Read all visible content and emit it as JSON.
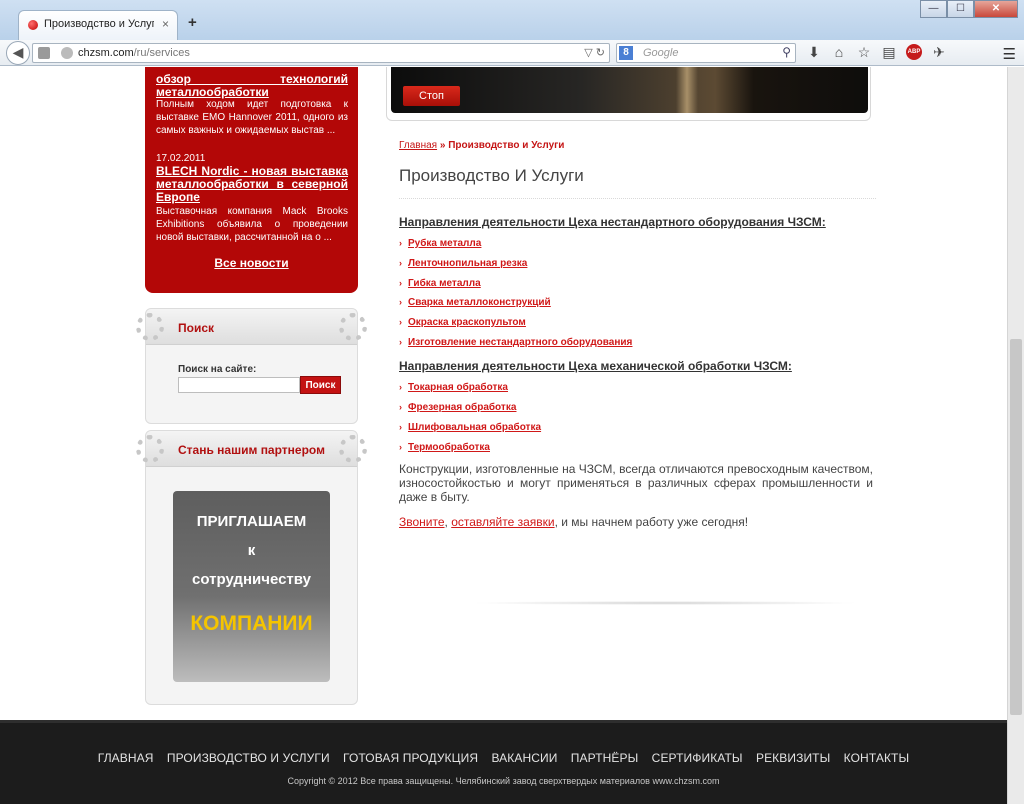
{
  "browser": {
    "tab_title": "Производство и Услуги | ...",
    "close_glyph": "×",
    "new_tab_glyph": "+",
    "url_domain": "chzsm.com",
    "url_path": "/ru/services",
    "search_engine_letter": "8",
    "search_placeholder": "Google",
    "window_min": "—",
    "window_max": "☐",
    "window_close": "✕"
  },
  "news": {
    "item1_title": "обзор технологий металлообработки",
    "item1_text": "Полным ходом идет подготовка к выставке EMO Hannover 2011, одного из самых важных и ожидаемых выстав ...",
    "item2_date": "17.02.2011",
    "item2_title": "BLECH Nordic - новая выставка металлообработки в северной Европе",
    "item2_text": "Выставочная компания Mack Brooks Exhibitions объявила о проведении новой выставки, рассчитанной на о ...",
    "all_news": "Все новости"
  },
  "search_box": {
    "title": "Поиск",
    "label": "Поиск на сайте:",
    "value": "",
    "button": "Поиск"
  },
  "partner_box": {
    "title": "Стань нашим партнером",
    "banner_line1": "ПРИГЛАШАЕМ",
    "banner_line2": "к",
    "banner_line3": "сотрудничеству",
    "banner_line4": "КОМПАНИИ"
  },
  "slider": {
    "stop_button": "Стоп"
  },
  "breadcrumb": {
    "home": "Главная",
    "separator": "»",
    "current": "Производство и Услуги"
  },
  "page_title": "Производство И Услуги",
  "section1": {
    "heading": "Направления деятельности Цеха нестандартного оборудования ЧЗСМ:",
    "items": [
      "Рубка металла",
      "Ленточнопильная резка",
      "Гибка металла",
      "Сварка металлоконструкций",
      "Окраска краскопультом",
      "Изготовление нестандартного оборудования"
    ]
  },
  "section2": {
    "heading": "Направления деятельности Цеха механической обработки ЧЗСМ:",
    "items": [
      "Токарная обработка",
      "Фрезерная обработка",
      "Шлифовальная обработка",
      "Термообработка"
    ]
  },
  "body_text": "Конструкции, изготовленные на ЧЗСМ, всегда отличаются превосходным качеством, износостойкостью и могут применяться в различных сферах промышленности и даже в быту.",
  "cta": {
    "link1": "Звоните",
    "comma": ", ",
    "link2": "оставляйте заявки",
    "rest": ", и мы начнем работу уже сегодня!"
  },
  "footer": {
    "nav": [
      "ГЛАВНАЯ",
      "ПРОИЗВОДСТВО И УСЛУГИ",
      "ГОТОВАЯ ПРОДУКЦИЯ",
      "ВАКАНСИИ",
      "ПАРТНЁРЫ",
      "СЕРТИФИКАТЫ",
      "РЕКВИЗИТЫ",
      "КОНТАКТЫ"
    ],
    "copyright": "Copyright © 2012 Все права защищены. Челябинский завод сверхтвердых материалов  www.chzsm.com"
  },
  "colors": {
    "brand_red": "#b30707",
    "link_red": "#d01818",
    "footer_bg": "#1c1c1c",
    "banner_yellow": "#f5c400"
  }
}
